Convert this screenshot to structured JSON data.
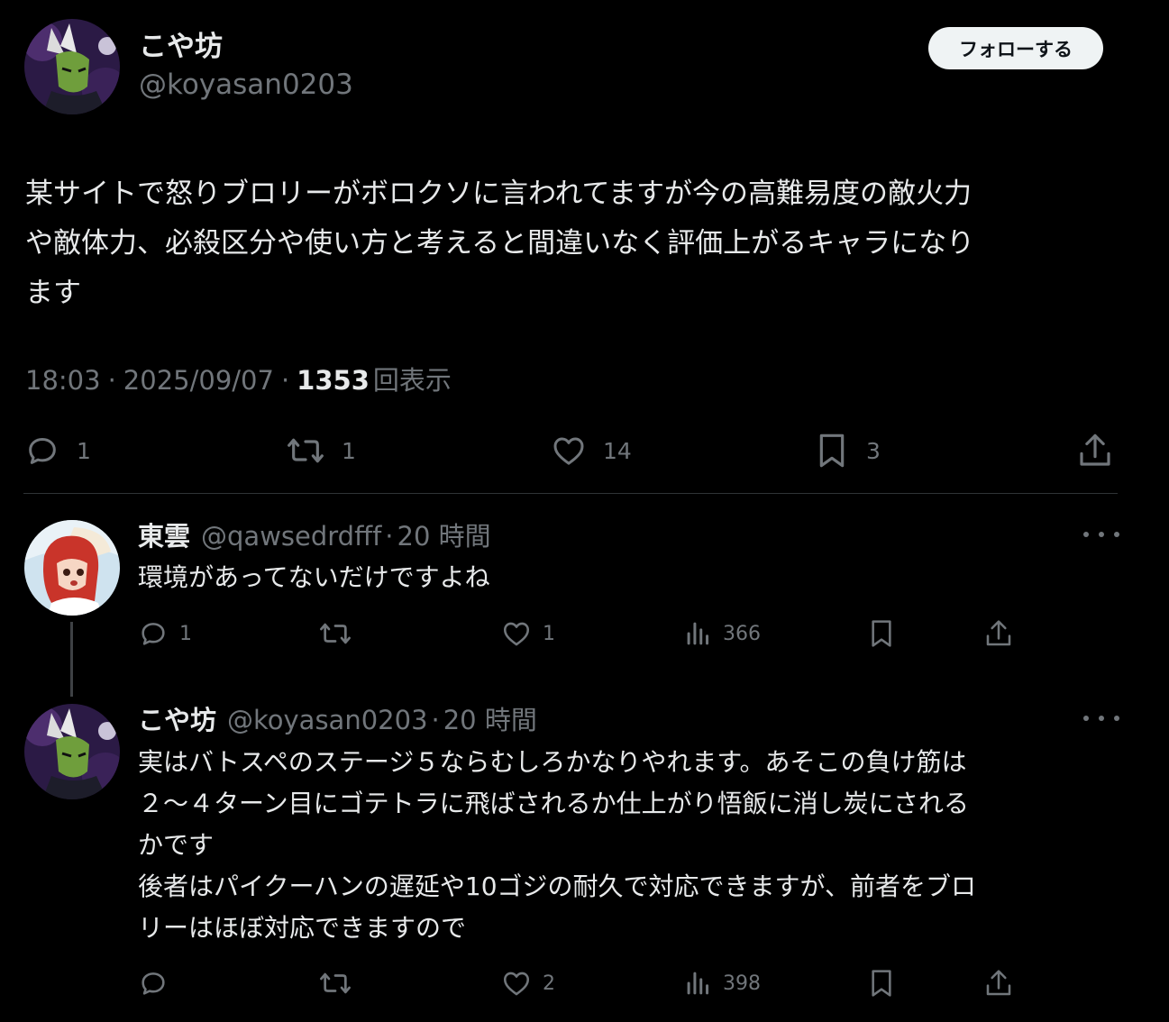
{
  "post": {
    "author_name": "こや坊",
    "author_handle": "@koyasan0203",
    "avatar_icon": "avatar-dark-character",
    "follow_label": "フォローする",
    "text": "某サイトで怒りブロリーがボロクソに言われてますが今の高難易度の敵火力\nや敵体力、必殺区分や使い方と考えると間違いなく評価上がるキャラになり\nます",
    "time": "18:03",
    "date": "2025/09/07",
    "sep": "·",
    "views_count": "1353",
    "views_label": "回表示",
    "replies": "1",
    "reposts": "1",
    "likes": "14",
    "bookmarks": "3"
  },
  "replies": [
    {
      "author_name": "東雲",
      "author_handle": "@qawsedrdfff",
      "sep": "·",
      "time_ago": "20 時間",
      "avatar_icon": "avatar-red-hair-character",
      "text": "環境があってないだけですよね",
      "reply_count": "1",
      "like_count": "1",
      "view_count": "366"
    },
    {
      "author_name": "こや坊",
      "author_handle": "@koyasan0203",
      "sep": "·",
      "time_ago": "20 時間",
      "avatar_icon": "avatar-dark-character",
      "text": "実はバトスペのステージ５ならむしろかなりやれます。あそこの負け筋は\n２〜４ターン目にゴテトラに飛ばされるか仕上がり悟飯に消し炭にされる\nかです\n後者はパイクーハンの遅延や10ゴジの耐久で対応できますが、前者をブロ\nリーはほぼ対応できますので",
      "like_count": "2",
      "view_count": "398"
    }
  ],
  "colors": {
    "background": "#000000",
    "text_primary": "#e7e9ea",
    "text_secondary": "#71767b",
    "divider": "#2f3336",
    "follow_button_bg": "#eff3f4"
  }
}
